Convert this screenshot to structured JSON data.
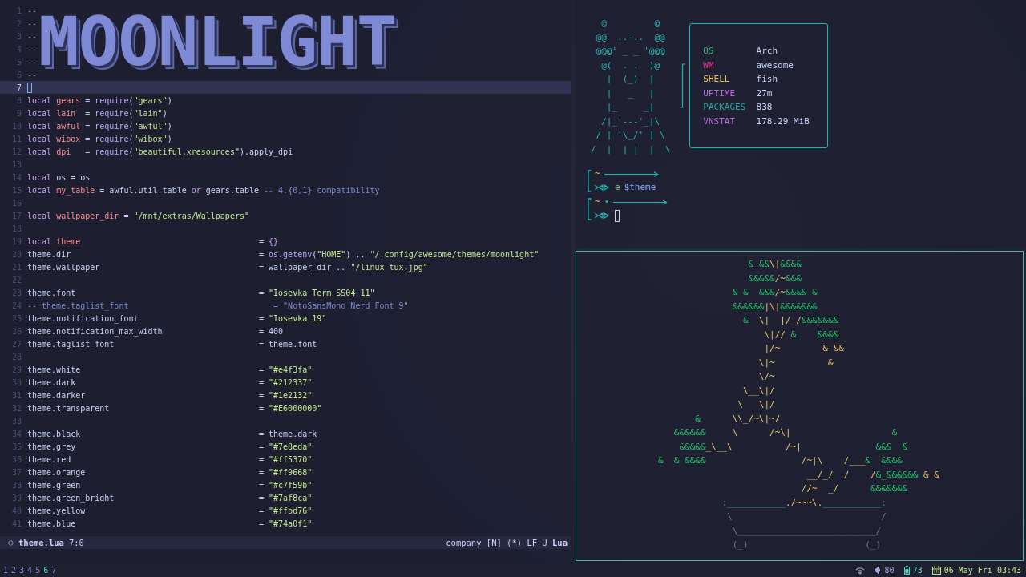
{
  "editor": {
    "banner": {
      "text": "MOONLIGHT",
      "lines": [
        {
          "number": "1",
          "segments": [
            {
              "kind": "cmt",
              "text": "--"
            }
          ]
        },
        {
          "number": "2",
          "segments": [
            {
              "kind": "cmt",
              "text": "--"
            }
          ]
        },
        {
          "number": "3",
          "segments": [
            {
              "kind": "cmt",
              "text": "--"
            }
          ]
        },
        {
          "number": "4",
          "segments": [
            {
              "kind": "cmt",
              "text": "--"
            }
          ]
        },
        {
          "number": "5",
          "segments": [
            {
              "kind": "cmt",
              "text": "--"
            }
          ]
        },
        {
          "number": "6",
          "segments": [
            {
              "kind": "cmt",
              "text": "--"
            }
          ]
        }
      ]
    },
    "lines": [
      {
        "number": "7",
        "current": true
      },
      {
        "number": "8",
        "current": false,
        "segments": [
          {
            "kind": "kw",
            "text": "local "
          },
          {
            "kind": "var",
            "text": "gears"
          },
          {
            "kind": "txt",
            "text": " = "
          },
          {
            "kind": "fn",
            "text": "require"
          },
          {
            "kind": "txt",
            "text": "("
          },
          {
            "kind": "str",
            "text": "\"gears\""
          },
          {
            "kind": "txt",
            "text": ")"
          }
        ]
      },
      {
        "number": "9",
        "current": false,
        "segments": [
          {
            "kind": "kw",
            "text": "local "
          },
          {
            "kind": "var",
            "text": "lain"
          },
          {
            "kind": "txt",
            "text": "  = "
          },
          {
            "kind": "fn",
            "text": "require"
          },
          {
            "kind": "txt",
            "text": "("
          },
          {
            "kind": "str",
            "text": "\"lain\""
          },
          {
            "kind": "txt",
            "text": ")"
          }
        ]
      },
      {
        "number": "10",
        "current": false,
        "segments": [
          {
            "kind": "kw",
            "text": "local "
          },
          {
            "kind": "var",
            "text": "awful"
          },
          {
            "kind": "txt",
            "text": " = "
          },
          {
            "kind": "fn",
            "text": "require"
          },
          {
            "kind": "txt",
            "text": "("
          },
          {
            "kind": "str",
            "text": "\"awful\""
          },
          {
            "kind": "txt",
            "text": ")"
          }
        ]
      },
      {
        "number": "11",
        "current": false,
        "segments": [
          {
            "kind": "kw",
            "text": "local "
          },
          {
            "kind": "var",
            "text": "wibox"
          },
          {
            "kind": "txt",
            "text": " = "
          },
          {
            "kind": "fn",
            "text": "require"
          },
          {
            "kind": "txt",
            "text": "("
          },
          {
            "kind": "str",
            "text": "\"wibox\""
          },
          {
            "kind": "txt",
            "text": ")"
          }
        ]
      },
      {
        "number": "12",
        "current": false,
        "segments": [
          {
            "kind": "kw",
            "text": "local "
          },
          {
            "kind": "var",
            "text": "dpi"
          },
          {
            "kind": "txt",
            "text": "   = "
          },
          {
            "kind": "fn",
            "text": "require"
          },
          {
            "kind": "txt",
            "text": "("
          },
          {
            "kind": "str",
            "text": "\"beautiful.xresources\""
          },
          {
            "kind": "txt",
            "text": ").apply_dpi"
          }
        ]
      },
      {
        "number": "13",
        "current": false
      },
      {
        "number": "14",
        "current": false,
        "segments": [
          {
            "kind": "kw",
            "text": "local "
          },
          {
            "kind": "txt",
            "text": "os = os"
          }
        ]
      },
      {
        "number": "15",
        "current": false,
        "segments": [
          {
            "kind": "kw",
            "text": "local "
          },
          {
            "kind": "var",
            "text": "my_table"
          },
          {
            "kind": "txt",
            "text": " = awful.util.table "
          },
          {
            "kind": "kw",
            "text": "or"
          },
          {
            "kind": "txt",
            "text": " gears.table "
          },
          {
            "kind": "cmt",
            "text": "-- 4.{0,1} compatibility"
          }
        ]
      },
      {
        "number": "16",
        "current": false
      },
      {
        "number": "17",
        "current": false,
        "segments": [
          {
            "kind": "kw",
            "text": "local "
          },
          {
            "kind": "var",
            "text": "wallpaper_dir"
          },
          {
            "kind": "txt",
            "text": " = "
          },
          {
            "kind": "str",
            "text": "\"/mnt/extras/Wallpapers\""
          }
        ]
      },
      {
        "number": "18",
        "current": false
      },
      {
        "number": "19",
        "current": false,
        "segments": [
          {
            "kind": "kw",
            "text": "local "
          },
          {
            "kind": "var",
            "text": "theme"
          }
        ],
        "value": [
          {
            "kind": "txt",
            "text": "= "
          },
          {
            "kind": "kw",
            "text": "{}"
          }
        ]
      },
      {
        "number": "20",
        "current": false,
        "segments": [
          {
            "kind": "txt",
            "text": "theme.dir"
          }
        ],
        "value": [
          {
            "kind": "txt",
            "text": "= "
          },
          {
            "kind": "fn",
            "text": "os.getenv"
          },
          {
            "kind": "txt",
            "text": "("
          },
          {
            "kind": "str",
            "text": "\"HOME\""
          },
          {
            "kind": "txt",
            "text": ") .. "
          },
          {
            "kind": "str",
            "text": "\"/.config/awesome/themes/moonlight\""
          }
        ]
      },
      {
        "number": "21",
        "current": false,
        "segments": [
          {
            "kind": "txt",
            "text": "theme.wallpaper"
          }
        ],
        "value": [
          {
            "kind": "txt",
            "text": "= wallpaper_dir .. "
          },
          {
            "kind": "str",
            "text": "\"/linux-tux.jpg\""
          }
        ]
      },
      {
        "number": "22",
        "current": false
      },
      {
        "number": "23",
        "current": false,
        "segments": [
          {
            "kind": "txt",
            "text": "theme.font"
          }
        ],
        "value": [
          {
            "kind": "txt",
            "text": "= "
          },
          {
            "kind": "str",
            "text": "\"Iosevka Term SS04 11\""
          }
        ]
      },
      {
        "number": "24",
        "current": false,
        "segments": [
          {
            "kind": "cmt",
            "text": "-- theme.taglist_font"
          }
        ],
        "value": [
          {
            "kind": "cmt",
            "text": "   = \"NotoSansMono Nerd Font 9\""
          }
        ]
      },
      {
        "number": "25",
        "current": false,
        "segments": [
          {
            "kind": "txt",
            "text": "theme.notification_font"
          }
        ],
        "value": [
          {
            "kind": "txt",
            "text": "= "
          },
          {
            "kind": "str",
            "text": "\"Iosevka 19\""
          }
        ]
      },
      {
        "number": "26",
        "current": false,
        "segments": [
          {
            "kind": "txt",
            "text": "theme.notification_max_width"
          }
        ],
        "value": [
          {
            "kind": "txt",
            "text": "= 400"
          }
        ]
      },
      {
        "number": "27",
        "current": false,
        "segments": [
          {
            "kind": "txt",
            "text": "theme.taglist_font"
          }
        ],
        "value": [
          {
            "kind": "txt",
            "text": "= theme.font"
          }
        ]
      },
      {
        "number": "28",
        "current": false
      },
      {
        "number": "29",
        "current": false,
        "segments": [
          {
            "kind": "txt",
            "text": "theme.white"
          }
        ],
        "value": [
          {
            "kind": "txt",
            "text": "= "
          },
          {
            "kind": "str",
            "text": "\"#e4f3fa\""
          }
        ]
      },
      {
        "number": "30",
        "current": false,
        "segments": [
          {
            "kind": "txt",
            "text": "theme.dark"
          }
        ],
        "value": [
          {
            "kind": "txt",
            "text": "= "
          },
          {
            "kind": "str",
            "text": "\"#212337\""
          }
        ]
      },
      {
        "number": "31",
        "current": false,
        "segments": [
          {
            "kind": "txt",
            "text": "theme.darker"
          }
        ],
        "value": [
          {
            "kind": "txt",
            "text": "= "
          },
          {
            "kind": "str",
            "text": "\"#1e2132\""
          }
        ]
      },
      {
        "number": "32",
        "current": false,
        "segments": [
          {
            "kind": "txt",
            "text": "theme.transparent"
          }
        ],
        "value": [
          {
            "kind": "txt",
            "text": "= "
          },
          {
            "kind": "str",
            "text": "\"#E6000000\""
          }
        ]
      },
      {
        "number": "33",
        "current": false
      },
      {
        "number": "34",
        "current": false,
        "segments": [
          {
            "kind": "txt",
            "text": "theme.black"
          }
        ],
        "value": [
          {
            "kind": "txt",
            "text": "= theme.dark"
          }
        ]
      },
      {
        "number": "35",
        "current": false,
        "segments": [
          {
            "kind": "txt",
            "text": "theme.grey"
          }
        ],
        "value": [
          {
            "kind": "txt",
            "text": "= "
          },
          {
            "kind": "str",
            "text": "\"#7e8eda\""
          }
        ]
      },
      {
        "number": "36",
        "current": false,
        "segments": [
          {
            "kind": "txt",
            "text": "theme.red"
          }
        ],
        "value": [
          {
            "kind": "txt",
            "text": "= "
          },
          {
            "kind": "str",
            "text": "\"#ff5370\""
          }
        ]
      },
      {
        "number": "37",
        "current": false,
        "segments": [
          {
            "kind": "txt",
            "text": "theme.orange"
          }
        ],
        "value": [
          {
            "kind": "txt",
            "text": "= "
          },
          {
            "kind": "str",
            "text": "\"#ff9668\""
          }
        ]
      },
      {
        "number": "38",
        "current": false,
        "segments": [
          {
            "kind": "txt",
            "text": "theme.green"
          }
        ],
        "value": [
          {
            "kind": "txt",
            "text": "= "
          },
          {
            "kind": "str",
            "text": "\"#c7f59b\""
          }
        ]
      },
      {
        "number": "39",
        "current": false,
        "segments": [
          {
            "kind": "txt",
            "text": "theme.green_bright"
          }
        ],
        "value": [
          {
            "kind": "txt",
            "text": "= "
          },
          {
            "kind": "str",
            "text": "\"#7af8ca\""
          }
        ]
      },
      {
        "number": "40",
        "current": false,
        "segments": [
          {
            "kind": "txt",
            "text": "theme.yellow"
          }
        ],
        "value": [
          {
            "kind": "txt",
            "text": "= "
          },
          {
            "kind": "str",
            "text": "\"#ffbd76\""
          }
        ]
      },
      {
        "number": "41",
        "current": false,
        "segments": [
          {
            "kind": "txt",
            "text": "theme.blue"
          }
        ],
        "value": [
          {
            "kind": "txt",
            "text": "= "
          },
          {
            "kind": "str",
            "text": "\"#74a0f1\""
          }
        ]
      }
    ],
    "status_line": {
      "file": "theme.lua",
      "position": "7:0",
      "right": "company [N] (*) LF U **Lua**"
    }
  },
  "terminal": {
    "tux_art": [
      "  @         @",
      " @@  ..-..  @@",
      " @@@' _ _ '@@@",
      "  @(  . .  )@",
      "   |  (_)  |",
      "   |   _   |",
      "   |_     _|",
      "  /|_'---'_|\\",
      " / | '\\_/' | \\",
      "/  |  | |  |  \\"
    ],
    "info": [
      {
        "key": "OS",
        "value": "Arch",
        "color": "#2bb673"
      },
      {
        "key": "WM",
        "value": "awesome",
        "color": "#e0358a"
      },
      {
        "key": "SHELL",
        "value": "fish",
        "color": "#e8c06b"
      },
      {
        "key": "UPTIME",
        "value": "27m",
        "color": "#b46fd6"
      },
      {
        "key": "PACKAGES",
        "value": "838",
        "color": "#20a5a0"
      },
      {
        "key": "VNSTAT",
        "value": "178.29 MiB",
        "color": "#b46fd6"
      }
    ],
    "prompts": [
      {
        "dir": "~",
        "dirty": false,
        "command": [
          {
            "kind": "cmd",
            "text": "e"
          },
          {
            "kind": "arg",
            "text": "$theme"
          }
        ],
        "cursor": false
      },
      {
        "dir": "~",
        "dirty": true,
        "dirty_mark": "•",
        "cursor": true
      }
    ]
  },
  "bonsai": {
    "lines": [
      [
        {
          "kind": "leaf",
          "text": "                 & &&"
        },
        {
          "kind": "branch",
          "text": "\\|"
        },
        {
          "kind": "leaf",
          "text": "&&&&"
        }
      ],
      [
        {
          "kind": "leaf",
          "text": "                 &&&&&"
        },
        {
          "kind": "branch",
          "text": "/~"
        },
        {
          "kind": "leaf",
          "text": "&&&"
        }
      ],
      [
        {
          "kind": "leaf",
          "text": "              & &  &&&"
        },
        {
          "kind": "branch",
          "text": "/~"
        },
        {
          "kind": "leaf",
          "text": "&&&& &"
        }
      ],
      [
        {
          "kind": "leaf",
          "text": "              &&&&&&"
        },
        {
          "kind": "branch",
          "text": "|\\|"
        },
        {
          "kind": "leaf",
          "text": "&&&&&&&"
        }
      ],
      [
        {
          "kind": "leaf",
          "text": "                &  "
        },
        {
          "kind": "branch",
          "text": "\\|  |/_/"
        },
        {
          "kind": "leaf",
          "text": "&&&&&&&"
        }
      ],
      [
        {
          "kind": "branch",
          "text": "                    \\|// "
        },
        {
          "kind": "leaf",
          "text": "&    &&&&"
        }
      ],
      [
        {
          "kind": "branch",
          "text": "                    |/~        & &&"
        }
      ],
      [
        {
          "kind": "branch",
          "text": "                   \\|~          &"
        }
      ],
      [
        {
          "kind": "branch",
          "text": "                   \\/~"
        }
      ],
      [
        {
          "kind": "branch",
          "text": "                \\__\\|/"
        }
      ],
      [
        {
          "kind": "branch",
          "text": "               \\   \\|/"
        }
      ],
      [
        {
          "kind": "leaf",
          "text": "       &"
        },
        {
          "kind": "branch",
          "text": "      \\\\_/~\\|~/"
        }
      ],
      [
        {
          "kind": "leaf",
          "text": "   &&&&&&"
        },
        {
          "kind": "branch",
          "text": "     \\      /~\\|"
        },
        {
          "kind": "leaf",
          "text": "                   &"
        }
      ],
      [
        {
          "kind": "leaf",
          "text": "    &&&&&"
        },
        {
          "kind": "branch",
          "text": "_\\__\\          /~|"
        },
        {
          "kind": "leaf",
          "text": "              &&&  &"
        }
      ],
      [
        {
          "kind": "leaf",
          "text": "&  & &&&&"
        },
        {
          "kind": "branch",
          "text": "                  /~|\\    /___"
        },
        {
          "kind": "leaf",
          "text": "&  &&&&"
        }
      ],
      [
        {
          "kind": "branch",
          "text": "                            __/_/  /    /"
        },
        {
          "kind": "leaf",
          "text": "&_&&&&&&"
        },
        {
          "kind": "branch",
          "text": " & &"
        }
      ],
      [
        {
          "kind": "branch",
          "text": "                           //~  _/"
        },
        {
          "kind": "leaf",
          "text": "      &&&&&&&"
        }
      ],
      [
        {
          "kind": "pot",
          "text": "            :"
        },
        {
          "kind": "rim",
          "text": "___________"
        },
        {
          "kind": "branch",
          "text": "./~~~\\."
        },
        {
          "kind": "rim",
          "text": "___________"
        },
        {
          "kind": "pot",
          "text": ":"
        }
      ],
      [
        {
          "kind": "pot",
          "text": "             \\                            /"
        }
      ],
      [
        {
          "kind": "pot",
          "text": "              \\__________________________/"
        }
      ],
      [
        {
          "kind": "pot",
          "text": "              (_)                      (_)"
        }
      ]
    ]
  },
  "bar": {
    "tags": [
      {
        "label": "1",
        "selected": false
      },
      {
        "label": "2",
        "selected": false
      },
      {
        "label": "3",
        "selected": false
      },
      {
        "label": "4",
        "selected": false
      },
      {
        "label": "5",
        "selected": false
      },
      {
        "label": "6",
        "selected": true
      },
      {
        "label": "7",
        "selected": false
      }
    ],
    "widgets": [
      {
        "kind": "wifi",
        "color": "#8a8fa8"
      },
      {
        "kind": "volume",
        "text": "80",
        "color": "#a9a1e1"
      },
      {
        "kind": "battery",
        "text": "73",
        "color": "#4fd6be"
      },
      {
        "kind": "clock",
        "text": "06 May Fri 03:43",
        "color": "#c3e88d"
      }
    ]
  }
}
